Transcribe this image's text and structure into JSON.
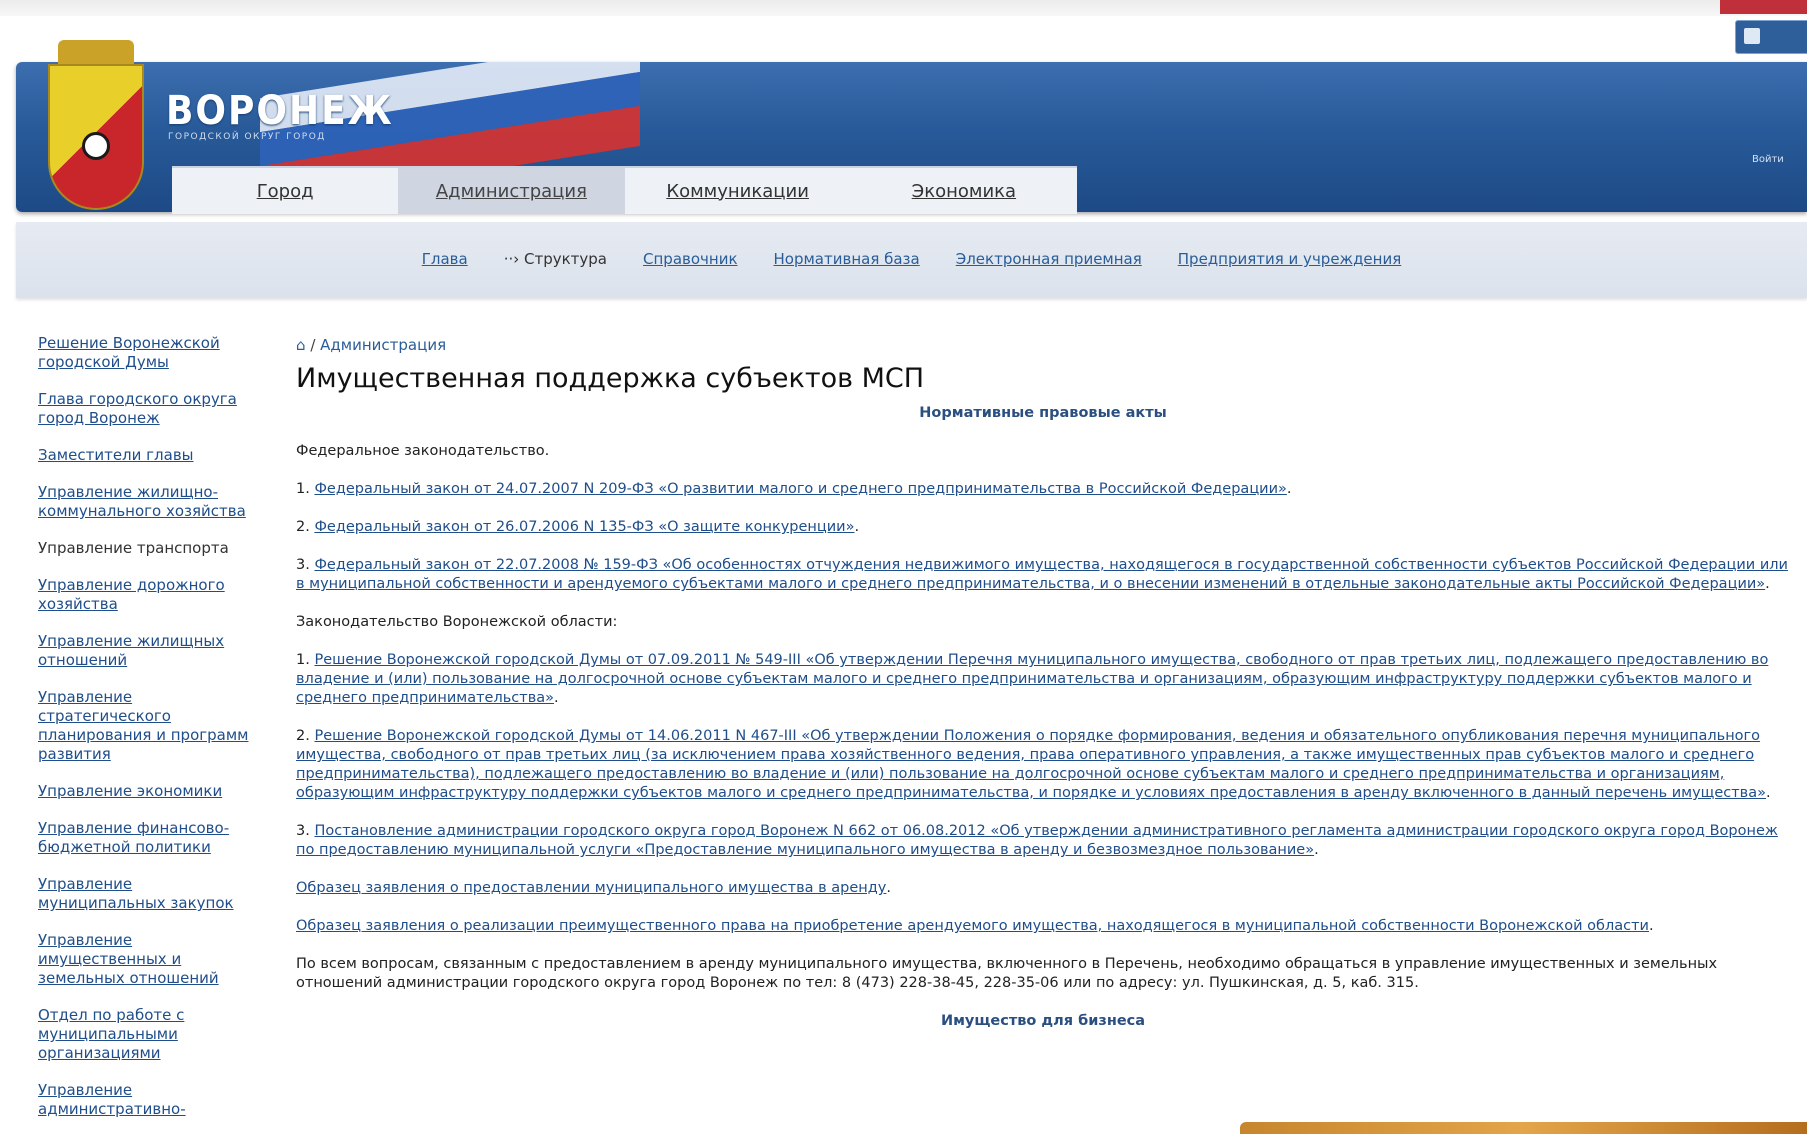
{
  "header": {
    "logo_text": "ВОРОНЕЖ",
    "logo_subtitle": "ГОРОДСКОЙ ОКРУГ ГОРОД",
    "main_tabs": [
      {
        "label": "Город",
        "active": false
      },
      {
        "label": "Администрация",
        "active": true
      },
      {
        "label": "Коммуникации",
        "active": false
      },
      {
        "label": "Экономика",
        "active": false
      }
    ],
    "right_label": "Войти"
  },
  "subnav": {
    "items": [
      {
        "label": "Глава",
        "current": false
      },
      {
        "label": "··› Структура",
        "current": true
      },
      {
        "label": "Справочник",
        "current": false
      },
      {
        "label": "Нормативная база",
        "current": false
      },
      {
        "label": "Электронная приемная",
        "current": false
      },
      {
        "label": "Предприятия и учреждения",
        "current": false
      }
    ]
  },
  "sidebar": {
    "items": [
      {
        "label": "Решение Воронежской городской Думы",
        "link": true
      },
      {
        "label": "Глава городского округа город Воронеж",
        "link": true
      },
      {
        "label": "Заместители главы",
        "link": true
      },
      {
        "label": "Управление жилищно-коммунального хозяйства",
        "link": true
      },
      {
        "label": "Управление транспорта",
        "link": false
      },
      {
        "label": "Управление дорожного хозяйства",
        "link": true
      },
      {
        "label": "Управление жилищных отношений",
        "link": true
      },
      {
        "label": "Управление стратегического планирования и программ развития",
        "link": true
      },
      {
        "label": "Управление экономики",
        "link": true
      },
      {
        "label": "Управление финансово-бюджетной политики",
        "link": true
      },
      {
        "label": "Управление муниципальных закупок",
        "link": true
      },
      {
        "label": "Управление имущественных и земельных отношений",
        "link": true
      },
      {
        "label": "Отдел по работе с муниципальными организациями",
        "link": true
      },
      {
        "label": "Управление административно-",
        "link": true
      }
    ]
  },
  "content": {
    "breadcrumb_home": "⌂",
    "breadcrumb_sep": "/",
    "breadcrumb_current": "Администрация",
    "title": "Имущественная поддержка субъектов МСП",
    "section1_heading": "Нормативные правовые акты",
    "federal_heading": "Федеральное законодательство.",
    "federal_items": [
      {
        "num": "1.",
        "link": "Федеральный закон от 24.07.2007 N 209-ФЗ «О развитии малого и среднего предпринимательства в Российской Федерации»",
        "tail": "."
      },
      {
        "num": "2.",
        "link": "Федеральный закон от 26.07.2006 N 135-ФЗ «О защите конкуренции»",
        "tail": "."
      },
      {
        "num": "3.",
        "link": "Федеральный закон от 22.07.2008 № 159-ФЗ «Об особенностях отчуждения недвижимого имущества, находящегося в государственной собственности субъектов Российской Федерации или в муниципальной собственности и арендуемого субъектами малого и среднего предпринимательства, и о внесении изменений в отдельные законодательные акты Российской Федерации»",
        "tail": "."
      }
    ],
    "regional_heading": "Законодательство Воронежской области:",
    "regional_items": [
      {
        "num": "1.",
        "link": "Решение Воронежской городской Думы от 07.09.2011 № 549-III «Об утверждении Перечня муниципального имущества, свободного от прав третьих лиц, подлежащего предоставлению во владение и (или) пользование на долгосрочной основе субъектам малого и среднего предпринимательства и организациям, образующим инфраструктуру поддержки субъектов малого и среднего предпринимательства»",
        "tail": "."
      },
      {
        "num": "2.",
        "link": "Решение Воронежской городской Думы от 14.06.2011 N 467-III «Об утверждении Положения о порядке формирования, ведения и обязательного опубликования перечня муниципального имущества, свободного от прав третьих лиц (за исключением права хозяйственного ведения, права оперативного управления, а также имущественных прав субъектов малого и среднего предпринимательства), подлежащего предоставлению во владение и (или) пользование на долгосрочной основе субъектам малого и среднего предпринимательства и организациям, образующим инфраструктуру поддержки субъектов малого и среднего предпринимательства, и порядке и условиях предоставления в аренду включенного в данный перечень имущества»",
        "tail": "."
      },
      {
        "num": "3.",
        "link": "Постановление администрации городского округа город Воронеж N 662 от 06.08.2012 «Об утверждении административного регламента администрации городского округа город Воронеж по предоставлению муниципальной услуги «Предоставление муниципального имущества в аренду и безвозмездное пользование»",
        "tail": "."
      }
    ],
    "sample1": {
      "link": "Образец заявления о предоставлении муниципального имущества в аренду",
      "tail": "."
    },
    "sample2": {
      "link": "Образец заявления о реализации преимущественного права на приобретение арендуемого имущества, находящегося в муниципальной собственности Воронежской области",
      "tail": "."
    },
    "contact_text": "По всем вопросам, связанным с предоставлением в аренду муниципального имущества, включенного в Перечень, необходимо обращаться в управление имущественных и земельных отношений администрации городского округа город Воронеж по тел: 8 (473) 228-38-45, 228-35-06 или по адресу: ул. Пушкинская, д. 5, каб. 315.",
    "section2_heading": "Имущество для бизнеса"
  },
  "colors": {
    "header_blue": "#285a99",
    "link_blue": "#1f4e8a",
    "subnav_bg": "#dbe2ec",
    "coat_yellow": "#e8cf2a",
    "coat_red": "#c8262a"
  }
}
